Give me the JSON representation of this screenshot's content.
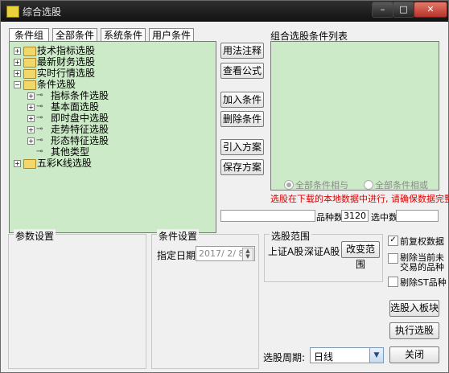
{
  "window": {
    "title": "综合选股",
    "min": "–",
    "max": "□",
    "close": "✕"
  },
  "tabs": [
    "条件组",
    "全部条件",
    "系统条件",
    "用户条件"
  ],
  "tree": [
    {
      "label": "技术指标选股",
      "pm": "+"
    },
    {
      "label": "最新财务选股",
      "pm": "+"
    },
    {
      "label": "实时行情选股",
      "pm": "+"
    },
    {
      "label": "条件选股",
      "pm": "−"
    },
    {
      "label": "指标条件选股",
      "pm": "+"
    },
    {
      "label": "基本面选股",
      "pm": "+"
    },
    {
      "label": "即时盘中选股",
      "pm": "+"
    },
    {
      "label": "走势特征选股",
      "pm": "+"
    },
    {
      "label": "形态特征选股",
      "pm": "+"
    },
    {
      "label": "其他类型",
      "pm": ""
    },
    {
      "label": "五彩K线选股",
      "pm": "+"
    }
  ],
  "buttons": {
    "usage_note": "用法注释",
    "view_formula": "查看公式",
    "add_condition": "加入条件",
    "delete_condition": "删除条件",
    "import_plan": "引入方案",
    "save_plan": "保存方案",
    "change_range": "改变范围",
    "select_to_block": "选股入板块",
    "execute_select": "执行选股",
    "close": "关闭"
  },
  "condition_list": {
    "label": "组合选股条件列表"
  },
  "logic": {
    "and_label": "全部条件相与",
    "or_label": "全部条件相或"
  },
  "notice": "选股在下载的本地数据中进行, 请确保数据完整",
  "counts": {
    "stock_count_label": "品种数",
    "stock_count_value": "3120",
    "selected_label": "选中数",
    "selected_value": ""
  },
  "params": {
    "title": "参数设置"
  },
  "condition_settings": {
    "title": "条件设置",
    "date_label": "指定日期:",
    "date_value": "2017/ 2/ 8"
  },
  "range": {
    "title": "选股范围",
    "sh": "上证A股",
    "sz": "深证A股"
  },
  "options": {
    "pre_adjust": {
      "label": "前复权数据",
      "checked": true
    },
    "exclude_untraded": {
      "label1": "剔除当前未",
      "label2": "交易的品种",
      "checked": false
    },
    "exclude_st": {
      "label": "剔除ST品种",
      "checked": false
    }
  },
  "period": {
    "label": "选股周期:",
    "value": "日线"
  },
  "colors": {
    "tree_bg": "#cdeac8",
    "notice_red": "#e00000"
  }
}
